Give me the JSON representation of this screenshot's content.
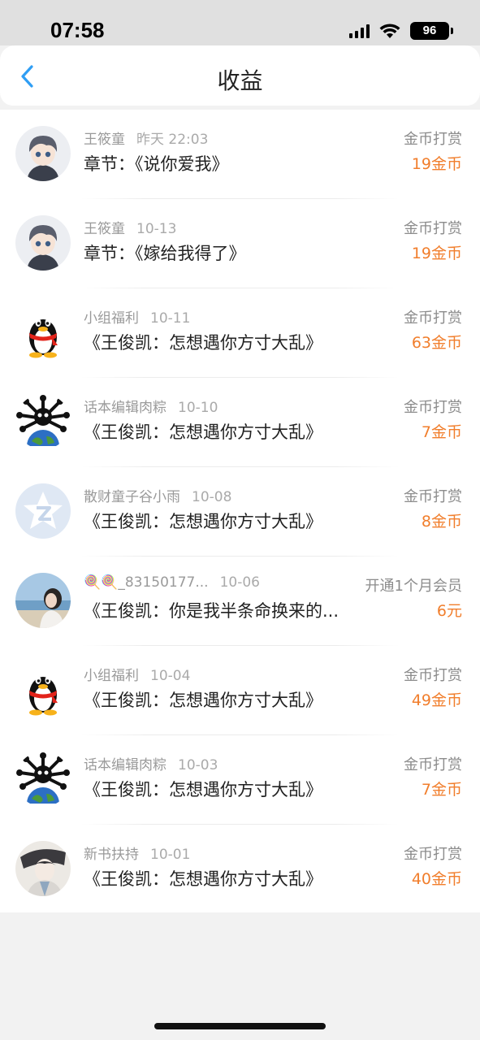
{
  "status_bar": {
    "time": "07:58",
    "battery": "96"
  },
  "nav": {
    "title": "收益",
    "accent_color": "#2f9ef4"
  },
  "items": [
    {
      "name": "王筱童",
      "date": "昨天 22:03",
      "title": "章节：《说你爱我》",
      "type": "金币打赏",
      "amount": "19金币",
      "avatar": "anime-boy-avatar"
    },
    {
      "name": "王筱童",
      "date": "10-13",
      "title": "章节：《嫁给我得了》",
      "type": "金币打赏",
      "amount": "19金币",
      "avatar": "anime-boy-avatar"
    },
    {
      "name": "小组福利",
      "date": "10-11",
      "title": "《王俊凯：怎想遇你方寸大乱》",
      "type": "金币打赏",
      "amount": "63金币",
      "avatar": "qq-penguin-avatar"
    },
    {
      "name": "话本编辑肉粽",
      "date": "10-10",
      "title": "《王俊凯：怎想遇你方寸大乱》",
      "type": "金币打赏",
      "amount": "7金币",
      "avatar": "earth-virus-avatar"
    },
    {
      "name": "散财童子谷小雨",
      "date": "10-08",
      "title": "《王俊凯：怎想遇你方寸大乱》",
      "type": "金币打赏",
      "amount": "8金币",
      "avatar": "qzone-star-avatar"
    },
    {
      "name": "🍭🍭_83150177...",
      "date": "10-06",
      "title": "《王俊凯：你是我半条命换来的...",
      "type": "开通1个月会员",
      "amount": "6元",
      "avatar": "beach-photo-avatar"
    },
    {
      "name": "小组福利",
      "date": "10-04",
      "title": "《王俊凯：怎想遇你方寸大乱》",
      "type": "金币打赏",
      "amount": "49金币",
      "avatar": "qq-penguin-avatar"
    },
    {
      "name": "话本编辑肉粽",
      "date": "10-03",
      "title": "《王俊凯：怎想遇你方寸大乱》",
      "type": "金币打赏",
      "amount": "7金币",
      "avatar": "earth-virus-avatar"
    },
    {
      "name": "新书扶持",
      "date": "10-01",
      "title": "《王俊凯：怎想遇你方寸大乱》",
      "type": "金币打赏",
      "amount": "40金币",
      "avatar": "ink-portrait-avatar"
    }
  ],
  "colors": {
    "amount": "#f17e2c",
    "meta_text": "#9a9a9a"
  }
}
